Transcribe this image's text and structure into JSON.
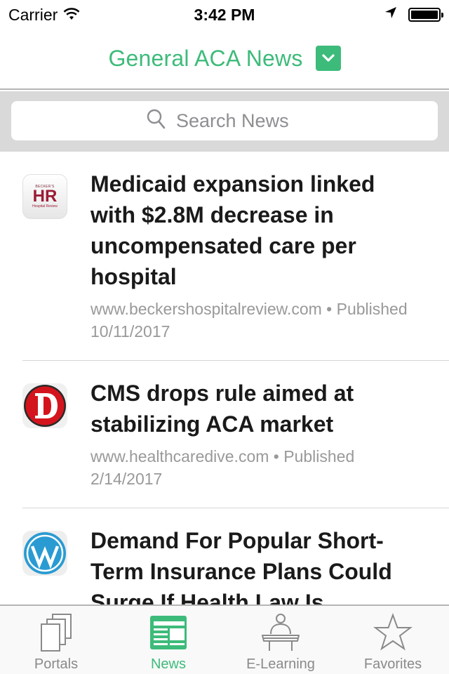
{
  "status_bar": {
    "carrier": "Carrier",
    "time": "3:42 PM",
    "icons": [
      "wifi-icon",
      "location-arrow-icon",
      "battery-icon"
    ]
  },
  "header": {
    "title": "General ACA News",
    "dropdown_icon": "chevron-down-icon",
    "accent_color": "#3dbb7a"
  },
  "search": {
    "placeholder": "Search News",
    "value": "",
    "icon": "search-icon"
  },
  "news": {
    "items": [
      {
        "source_icon": "beckers-hr-logo",
        "icon_text_top": "BECKER'S",
        "icon_text_main": "HR",
        "icon_text_sub": "Hospital Review",
        "title": "Medicaid expansion linked with $2.8M decrease in uncompensated care per hospital",
        "meta": "www.beckershospitalreview.com • Published 10/11/2017"
      },
      {
        "source_icon": "healthcare-dive-logo",
        "icon_text_main": "D",
        "title": "CMS drops rule aimed at stabilizing ACA market",
        "meta": "www.healthcaredive.com • Published 2/14/2017"
      },
      {
        "source_icon": "wordpress-logo",
        "title": "Demand For Popular Short-Term Insurance Plans Could Surge If Health Law Is",
        "meta": ""
      }
    ]
  },
  "tab_bar": {
    "active_index": 1,
    "tabs": [
      {
        "label": "Portals",
        "icon": "portals-icon"
      },
      {
        "label": "News",
        "icon": "newspaper-icon"
      },
      {
        "label": "E-Learning",
        "icon": "lectern-icon"
      },
      {
        "label": "Favorites",
        "icon": "star-icon"
      }
    ]
  }
}
